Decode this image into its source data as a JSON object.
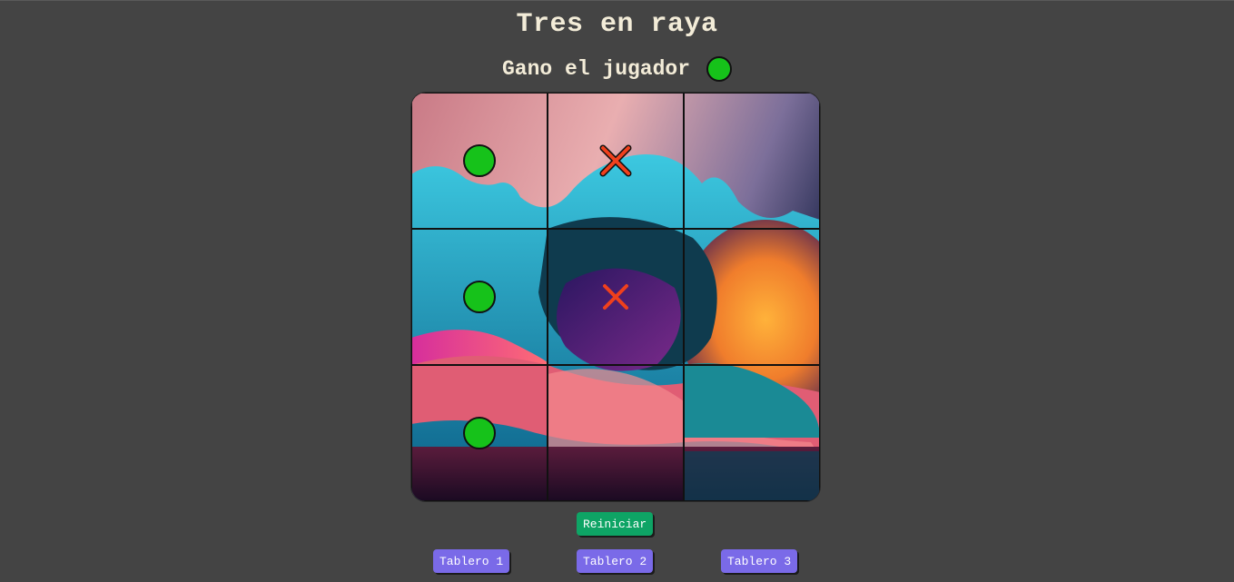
{
  "title": "Tres en raya",
  "status": {
    "text": "Gano el jugador",
    "winner_token": "circle",
    "winner_color": "#16c21a"
  },
  "board": {
    "cells": [
      [
        "O",
        "X",
        ""
      ],
      [
        "O",
        "X",
        ""
      ],
      [
        "O",
        "",
        ""
      ]
    ],
    "o_color": "#16c21a",
    "x_color": "#f0401c"
  },
  "buttons": {
    "reset": "Reiniciar",
    "boards": [
      "Tablero 1",
      "Tablero 2",
      "Tablero 3"
    ]
  },
  "colors": {
    "background": "#444444",
    "text": "#f3ecd8",
    "reset_button": "#0ea465",
    "board_button": "#7a6ae8"
  }
}
